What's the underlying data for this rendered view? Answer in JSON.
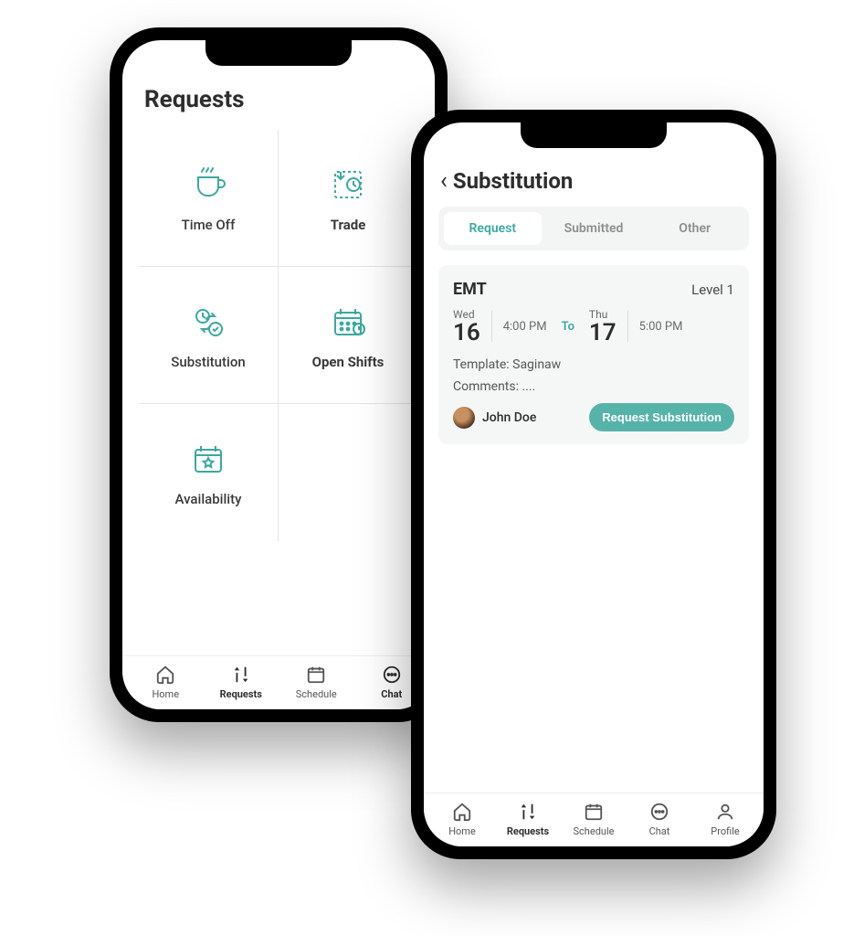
{
  "colors": {
    "accent": "#3aa9a0",
    "text": "#2d2d2d",
    "muted": "#6a6a6a"
  },
  "phoneA": {
    "title": "Requests",
    "grid": {
      "time_off": "Time Off",
      "trade": "Trade",
      "substitution": "Substitution",
      "open_shifts": "Open Shifts",
      "availability": "Availability"
    },
    "nav": {
      "home": "Home",
      "requests": "Requests",
      "schedule": "Schedule",
      "chat": "Chat"
    }
  },
  "phoneB": {
    "title": "Substitution",
    "tabs": {
      "request": "Request",
      "submitted": "Submitted",
      "other": "Other"
    },
    "card": {
      "role": "EMT",
      "level": "Level 1",
      "start": {
        "dow": "Wed",
        "day": "16",
        "time": "4:00 PM"
      },
      "end": {
        "dow": "Thu",
        "day": "17",
        "time": "5:00 PM"
      },
      "to_label": "To",
      "template_line": "Template: Saginaw",
      "comments_line": "Comments: ....",
      "user_name": "John Doe",
      "button_label": "Request Substitution"
    },
    "nav": {
      "home": "Home",
      "requests": "Requests",
      "schedule": "Schedule",
      "chat": "Chat",
      "profile": "Profile"
    }
  }
}
